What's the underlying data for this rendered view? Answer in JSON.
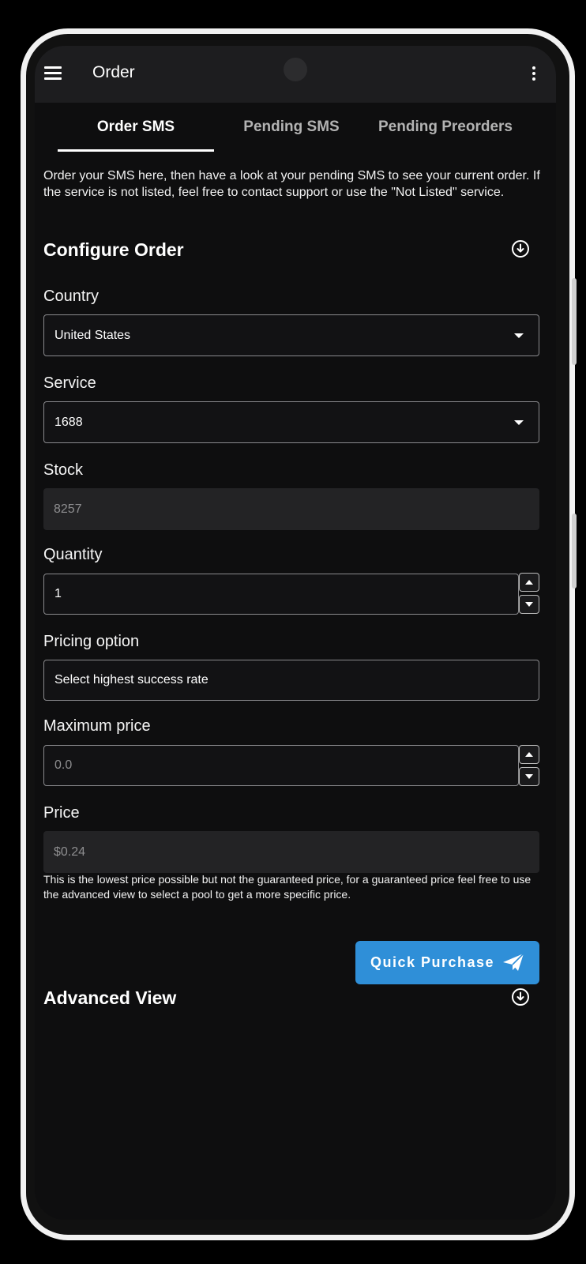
{
  "app_bar": {
    "title": "Order",
    "menu_icon": "hamburger-menu-icon",
    "overflow_icon": "more-vertical-icon"
  },
  "tabs": [
    {
      "label": "Order SMS",
      "active": true
    },
    {
      "label": "Pending SMS",
      "active": false
    },
    {
      "label": "Pending Preorders",
      "active": false
    }
  ],
  "intro_text": "Order your SMS here, then have a look at your pending SMS to see your current order. If the service is not listed, feel free to contact support or use the \"Not Listed\" service.",
  "configure_order": {
    "title": "Configure Order",
    "toggle_icon": "circle-arrow-down-icon",
    "country": {
      "label": "Country",
      "value": "United States"
    },
    "service": {
      "label": "Service",
      "value": "1688"
    },
    "stock": {
      "label": "Stock",
      "value": "8257"
    },
    "quantity": {
      "label": "Quantity",
      "value": "1"
    },
    "pricing_option": {
      "label": "Pricing option",
      "value": "Select highest success rate"
    },
    "maximum_price": {
      "label": "Maximum price",
      "placeholder": "0.0"
    },
    "price": {
      "label": "Price",
      "value": "$0.24"
    },
    "note": "This is the lowest price possible but not the guaranteed price, for a guaranteed price feel free to use the advanced view to select a pool to get a more specific price.",
    "quick_purchase": {
      "label": "Quick Purchase",
      "icon": "paper-plane-icon"
    }
  },
  "advanced_view": {
    "title": "Advanced View",
    "toggle_icon": "circle-arrow-down-icon"
  },
  "colors": {
    "background": "#0e0e0f",
    "app_bar": "#1d1d1f",
    "accent": "#2f8fd8"
  }
}
